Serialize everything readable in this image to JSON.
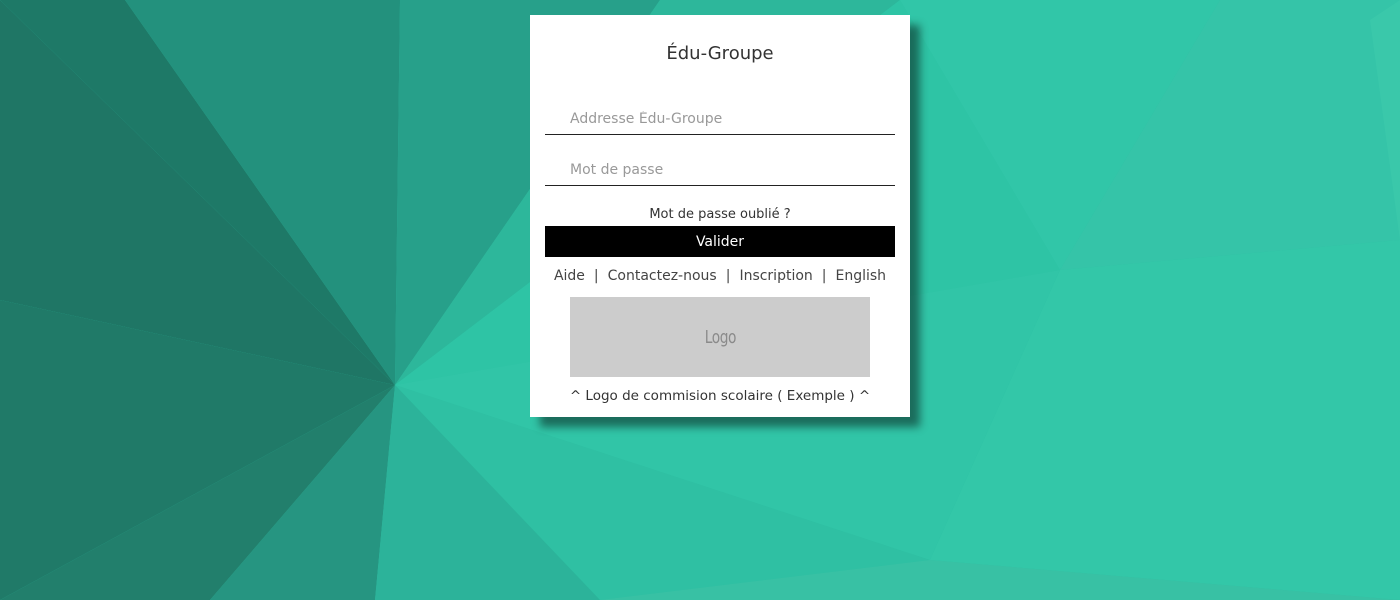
{
  "colors": {
    "background_accent": "#2ec4a5",
    "card": "#ffffff",
    "button": "#000000",
    "logo_placeholder": "#cccccc"
  },
  "login": {
    "title": "Édu-Groupe",
    "email_placeholder": "Addresse Édu-Groupe",
    "password_placeholder": "Mot de passe",
    "forgot_password": "Mot de passe oublié ?",
    "submit_label": "Valider"
  },
  "links": {
    "help": "Aide",
    "contact": "Contactez-nous",
    "signup": "Inscription",
    "language": "English",
    "separator": "|"
  },
  "logo": {
    "text": "Logo",
    "caption_prefix": "^ Logo de commision scolaire ( ",
    "caption_example": "Exemple",
    "caption_suffix": " ) ^"
  }
}
